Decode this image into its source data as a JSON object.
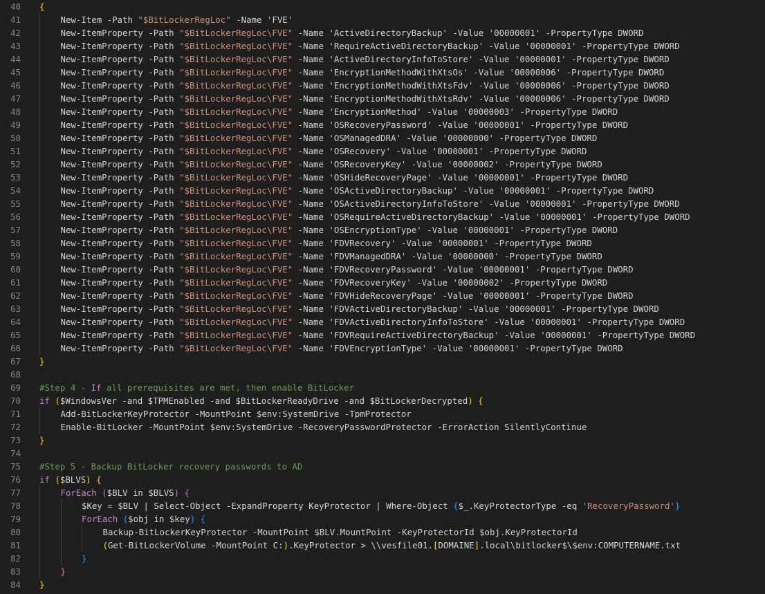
{
  "editor": {
    "colors": {
      "background": "#1e1e1e",
      "line_number": "#858585",
      "plain": "#d4d4d4",
      "string": "#ce9178",
      "comment": "#6a9955",
      "keyword": "#c586c0",
      "bracket_1": "#ffd700",
      "bracket_2": "#da70d6",
      "bracket_3": "#179fff"
    },
    "lines": [
      {
        "num": "40",
        "indent": 0,
        "tokens": [
          [
            "{",
            "b1"
          ]
        ]
      },
      {
        "num": "41",
        "indent": 1,
        "tokens": [
          [
            "New-Item -Path ",
            "plain"
          ],
          [
            "\"$BitLockerRegLoc\"",
            "str"
          ],
          [
            " -Name 'FVE'",
            "plain"
          ]
        ]
      },
      {
        "num": "42",
        "indent": 1,
        "tokens": [
          [
            "New-ItemProperty -Path ",
            "plain"
          ],
          [
            "\"$BitLockerRegLoc\\FVE\"",
            "str"
          ],
          [
            " -Name 'ActiveDirectoryBackup' -Value '00000001' -PropertyType DWORD",
            "plain"
          ]
        ]
      },
      {
        "num": "43",
        "indent": 1,
        "tokens": [
          [
            "New-ItemProperty -Path ",
            "plain"
          ],
          [
            "\"$BitLockerRegLoc\\FVE\"",
            "str"
          ],
          [
            " -Name 'RequireActiveDirectoryBackup' -Value '00000001' -PropertyType DWORD",
            "plain"
          ]
        ]
      },
      {
        "num": "44",
        "indent": 1,
        "tokens": [
          [
            "New-ItemProperty -Path ",
            "plain"
          ],
          [
            "\"$BitLockerRegLoc\\FVE\"",
            "str"
          ],
          [
            " -Name 'ActiveDirectoryInfoToStore' -Value '00000001' -PropertyType DWORD",
            "plain"
          ]
        ]
      },
      {
        "num": "45",
        "indent": 1,
        "tokens": [
          [
            "New-ItemProperty -Path ",
            "plain"
          ],
          [
            "\"$BitLockerRegLoc\\FVE\"",
            "str"
          ],
          [
            " -Name 'EncryptionMethodWithXtsOs' -Value '00000006' -PropertyType DWORD",
            "plain"
          ]
        ]
      },
      {
        "num": "46",
        "indent": 1,
        "tokens": [
          [
            "New-ItemProperty -Path ",
            "plain"
          ],
          [
            "\"$BitLockerRegLoc\\FVE\"",
            "str"
          ],
          [
            " -Name 'EncryptionMethodWithXtsFdv' -Value '00000006' -PropertyType DWORD",
            "plain"
          ]
        ]
      },
      {
        "num": "47",
        "indent": 1,
        "tokens": [
          [
            "New-ItemProperty -Path ",
            "plain"
          ],
          [
            "\"$BitLockerRegLoc\\FVE\"",
            "str"
          ],
          [
            " -Name 'EncryptionMethodWithXtsRdv' -Value '00000006' -PropertyType DWORD",
            "plain"
          ]
        ]
      },
      {
        "num": "48",
        "indent": 1,
        "tokens": [
          [
            "New-ItemProperty -Path ",
            "plain"
          ],
          [
            "\"$BitLockerRegLoc\\FVE\"",
            "str"
          ],
          [
            " -Name 'EncryptionMethod' -Value '00000003' -PropertyType DWORD",
            "plain"
          ]
        ]
      },
      {
        "num": "49",
        "indent": 1,
        "tokens": [
          [
            "New-ItemProperty -Path ",
            "plain"
          ],
          [
            "\"$BitLockerRegLoc\\FVE\"",
            "str"
          ],
          [
            " -Name 'OSRecoveryPassword' -Value '00000001' -PropertyType DWORD",
            "plain"
          ]
        ]
      },
      {
        "num": "50",
        "indent": 1,
        "tokens": [
          [
            "New-ItemProperty -Path ",
            "plain"
          ],
          [
            "\"$BitLockerRegLoc\\FVE\"",
            "str"
          ],
          [
            " -Name 'OSManagedDRA' -Value '00000000' -PropertyType DWORD",
            "plain"
          ]
        ]
      },
      {
        "num": "51",
        "indent": 1,
        "tokens": [
          [
            "New-ItemProperty -Path ",
            "plain"
          ],
          [
            "\"$BitLockerRegLoc\\FVE\"",
            "str"
          ],
          [
            " -Name 'OSRecovery' -Value '00000001' -PropertyType DWORD",
            "plain"
          ]
        ]
      },
      {
        "num": "52",
        "indent": 1,
        "tokens": [
          [
            "New-ItemProperty -Path ",
            "plain"
          ],
          [
            "\"$BitLockerRegLoc\\FVE\"",
            "str"
          ],
          [
            " -Name 'OSRecoveryKey' -Value '00000002' -PropertyType DWORD",
            "plain"
          ]
        ]
      },
      {
        "num": "53",
        "indent": 1,
        "tokens": [
          [
            "New-ItemProperty -Path ",
            "plain"
          ],
          [
            "\"$BitLockerRegLoc\\FVE\"",
            "str"
          ],
          [
            " -Name 'OSHideRecoveryPage' -Value '00000001' -PropertyType DWORD",
            "plain"
          ]
        ]
      },
      {
        "num": "54",
        "indent": 1,
        "tokens": [
          [
            "New-ItemProperty -Path ",
            "plain"
          ],
          [
            "\"$BitLockerRegLoc\\FVE\"",
            "str"
          ],
          [
            " -Name 'OSActiveDirectoryBackup' -Value '00000001' -PropertyType DWORD",
            "plain"
          ]
        ]
      },
      {
        "num": "55",
        "indent": 1,
        "tokens": [
          [
            "New-ItemProperty -Path ",
            "plain"
          ],
          [
            "\"$BitLockerRegLoc\\FVE\"",
            "str"
          ],
          [
            " -Name 'OSActiveDirectoryInfoToStore' -Value '00000001' -PropertyType DWORD",
            "plain"
          ]
        ]
      },
      {
        "num": "56",
        "indent": 1,
        "tokens": [
          [
            "New-ItemProperty -Path ",
            "plain"
          ],
          [
            "\"$BitLockerRegLoc\\FVE\"",
            "str"
          ],
          [
            " -Name 'OSRequireActiveDirectoryBackup' -Value '00000001' -PropertyType DWORD",
            "plain"
          ]
        ]
      },
      {
        "num": "57",
        "indent": 1,
        "tokens": [
          [
            "New-ItemProperty -Path ",
            "plain"
          ],
          [
            "\"$BitLockerRegLoc\\FVE\"",
            "str"
          ],
          [
            " -Name 'OSEncryptionType' -Value '00000001' -PropertyType DWORD",
            "plain"
          ]
        ]
      },
      {
        "num": "58",
        "indent": 1,
        "tokens": [
          [
            "New-ItemProperty -Path ",
            "plain"
          ],
          [
            "\"$BitLockerRegLoc\\FVE\"",
            "str"
          ],
          [
            " -Name 'FDVRecovery' -Value '00000001' -PropertyType DWORD",
            "plain"
          ]
        ]
      },
      {
        "num": "59",
        "indent": 1,
        "tokens": [
          [
            "New-ItemProperty -Path ",
            "plain"
          ],
          [
            "\"$BitLockerRegLoc\\FVE\"",
            "str"
          ],
          [
            " -Name 'FDVManagedDRA' -Value '00000000' -PropertyType DWORD",
            "plain"
          ]
        ]
      },
      {
        "num": "60",
        "indent": 1,
        "tokens": [
          [
            "New-ItemProperty -Path ",
            "plain"
          ],
          [
            "\"$BitLockerRegLoc\\FVE\"",
            "str"
          ],
          [
            " -Name 'FDVRecoveryPassword' -Value '00000001' -PropertyType DWORD",
            "plain"
          ]
        ]
      },
      {
        "num": "61",
        "indent": 1,
        "tokens": [
          [
            "New-ItemProperty -Path ",
            "plain"
          ],
          [
            "\"$BitLockerRegLoc\\FVE\"",
            "str"
          ],
          [
            " -Name 'FDVRecoveryKey' -Value '00000002' -PropertyType DWORD",
            "plain"
          ]
        ]
      },
      {
        "num": "62",
        "indent": 1,
        "tokens": [
          [
            "New-ItemProperty -Path ",
            "plain"
          ],
          [
            "\"$BitLockerRegLoc\\FVE\"",
            "str"
          ],
          [
            " -Name 'FDVHideRecoveryPage' -Value '00000001' -PropertyType DWORD",
            "plain"
          ]
        ]
      },
      {
        "num": "63",
        "indent": 1,
        "tokens": [
          [
            "New-ItemProperty -Path ",
            "plain"
          ],
          [
            "\"$BitLockerRegLoc\\FVE\"",
            "str"
          ],
          [
            " -Name 'FDVActiveDirectoryBackup' -Value '00000001' -PropertyType DWORD",
            "plain"
          ]
        ]
      },
      {
        "num": "64",
        "indent": 1,
        "tokens": [
          [
            "New-ItemProperty -Path ",
            "plain"
          ],
          [
            "\"$BitLockerRegLoc\\FVE\"",
            "str"
          ],
          [
            " -Name 'FDVActiveDirectoryInfoToStore' -Value '00000001' -PropertyType DWORD",
            "plain"
          ]
        ]
      },
      {
        "num": "65",
        "indent": 1,
        "tokens": [
          [
            "New-ItemProperty -Path ",
            "plain"
          ],
          [
            "\"$BitLockerRegLoc\\FVE\"",
            "str"
          ],
          [
            " -Name 'FDVRequireActiveDirectoryBackup' -Value '00000001' -PropertyType DWORD",
            "plain"
          ]
        ]
      },
      {
        "num": "66",
        "indent": 1,
        "tokens": [
          [
            "New-ItemProperty -Path ",
            "plain"
          ],
          [
            "\"$BitLockerRegLoc\\FVE\"",
            "str"
          ],
          [
            " -Name 'FDVEncryptionType' -Value '00000001' -PropertyType DWORD",
            "plain"
          ]
        ]
      },
      {
        "num": "67",
        "indent": 0,
        "tokens": [
          [
            "}",
            "b1"
          ]
        ]
      },
      {
        "num": "68",
        "indent": 0,
        "tokens": []
      },
      {
        "num": "69",
        "indent": 0,
        "tokens": [
          [
            "#Step 4 - ",
            "comment"
          ],
          [
            "If",
            "keyword"
          ],
          [
            " all prerequisites are met, then enable BitLocker",
            "comment"
          ]
        ]
      },
      {
        "num": "70",
        "indent": 0,
        "tokens": [
          [
            "if",
            "keyword"
          ],
          [
            " ",
            "plain"
          ],
          [
            "(",
            "b1"
          ],
          [
            "$WindowsVer -and $TPMEnabled -and $BitLockerReadyDrive -and $BitLockerDecrypted",
            "plain"
          ],
          [
            ")",
            "b1"
          ],
          [
            " ",
            "plain"
          ],
          [
            "{",
            "b1"
          ]
        ]
      },
      {
        "num": "71",
        "indent": 1,
        "tokens": [
          [
            "Add-BitLockerKeyProtector -MountPoint $env:SystemDrive -TpmProtector",
            "plain"
          ]
        ]
      },
      {
        "num": "72",
        "indent": 1,
        "tokens": [
          [
            "Enable-BitLocker -MountPoint $env:SystemDrive -RecoveryPasswordProtector -ErrorAction SilentlyContinue",
            "plain"
          ]
        ]
      },
      {
        "num": "73",
        "indent": 0,
        "tokens": [
          [
            "}",
            "b1"
          ]
        ]
      },
      {
        "num": "74",
        "indent": 0,
        "tokens": []
      },
      {
        "num": "75",
        "indent": 0,
        "tokens": [
          [
            "#Step 5 - Backup BitLocker recovery passwords to AD",
            "comment"
          ]
        ]
      },
      {
        "num": "76",
        "indent": 0,
        "tokens": [
          [
            "if",
            "keyword"
          ],
          [
            " ",
            "plain"
          ],
          [
            "(",
            "b1"
          ],
          [
            "$BLVS",
            "plain"
          ],
          [
            ")",
            "b1"
          ],
          [
            " ",
            "plain"
          ],
          [
            "{",
            "b1"
          ]
        ]
      },
      {
        "num": "77",
        "indent": 1,
        "tokens": [
          [
            "ForEach",
            "keyword"
          ],
          [
            " ",
            "plain"
          ],
          [
            "(",
            "b2"
          ],
          [
            "$BLV in $BLVS",
            "plain"
          ],
          [
            ")",
            "b2"
          ],
          [
            " ",
            "plain"
          ],
          [
            "{",
            "b2"
          ]
        ]
      },
      {
        "num": "78",
        "indent": 2,
        "tokens": [
          [
            "$Key = $BLV | Select-Object -ExpandProperty KeyProtector | Where-Object ",
            "plain"
          ],
          [
            "{",
            "b3"
          ],
          [
            "$_.KeyProtectorType -eq ",
            "plain"
          ],
          [
            "'RecoveryPassword'",
            "str"
          ],
          [
            "}",
            "b3"
          ]
        ]
      },
      {
        "num": "79",
        "indent": 2,
        "tokens": [
          [
            "ForEach",
            "keyword"
          ],
          [
            " ",
            "plain"
          ],
          [
            "(",
            "b3"
          ],
          [
            "$obj in $key",
            "plain"
          ],
          [
            ")",
            "b3"
          ],
          [
            " ",
            "plain"
          ],
          [
            "{",
            "b3"
          ]
        ]
      },
      {
        "num": "80",
        "indent": 3,
        "tokens": [
          [
            "Backup-BitLockerKeyProtector -MountPoint $BLV.MountPoint -KeyProtectorId $obj.KeyProtectorId",
            "plain"
          ]
        ]
      },
      {
        "num": "81",
        "indent": 3,
        "tokens": [
          [
            "(",
            "b1"
          ],
          [
            "Get-BitLockerVolume -MountPoint C:",
            "plain"
          ],
          [
            ")",
            "b1"
          ],
          [
            ".KeyProtector > \\\\vesfile01.",
            "plain"
          ],
          [
            "[",
            "b1"
          ],
          [
            "DOMAINE",
            "plain"
          ],
          [
            "]",
            "b1"
          ],
          [
            ".local\\bitlocker$\\$env:COMPUTERNAME.txt",
            "plain"
          ]
        ]
      },
      {
        "num": "82",
        "indent": 2,
        "tokens": [
          [
            "}",
            "b3"
          ]
        ]
      },
      {
        "num": "83",
        "indent": 1,
        "tokens": [
          [
            "}",
            "b2"
          ]
        ]
      },
      {
        "num": "84",
        "indent": 0,
        "tokens": [
          [
            "}",
            "b1"
          ]
        ]
      }
    ]
  }
}
